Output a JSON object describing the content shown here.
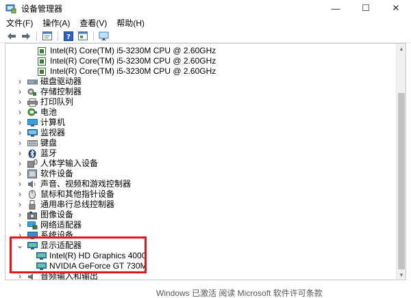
{
  "window": {
    "title": "设备管理器",
    "controls": {
      "minimize": "—",
      "maximize": "☐",
      "close": "✕"
    }
  },
  "menu": [
    {
      "label": "文件(F)"
    },
    {
      "label": "操作(A)"
    },
    {
      "label": "查看(V)"
    },
    {
      "label": "帮助(H)"
    }
  ],
  "toolbar": {
    "icons": [
      "back-arrow-icon",
      "forward-arrow-icon",
      "properties-icon",
      "help-icon",
      "update-icon",
      "monitor-scan-icon"
    ]
  },
  "tree": {
    "processors": [
      {
        "label": "Intel(R) Core(TM) i5-3230M CPU @ 2.60GHz"
      },
      {
        "label": "Intel(R) Core(TM) i5-3230M CPU @ 2.60GHz"
      },
      {
        "label": "Intel(R) Core(TM) i5-3230M CPU @ 2.60GHz"
      }
    ],
    "categories": [
      {
        "label": "磁盘驱动器",
        "icon": "disk-drive-icon",
        "expanded": false
      },
      {
        "label": "存储控制器",
        "icon": "storage-controller-icon",
        "expanded": false
      },
      {
        "label": "打印队列",
        "icon": "print-queue-icon",
        "expanded": false
      },
      {
        "label": "电池",
        "icon": "battery-icon",
        "expanded": false
      },
      {
        "label": "计算机",
        "icon": "computer-icon",
        "expanded": false
      },
      {
        "label": "监视器",
        "icon": "monitor-icon",
        "expanded": false
      },
      {
        "label": "键盘",
        "icon": "keyboard-icon",
        "expanded": false
      },
      {
        "label": "蓝牙",
        "icon": "bluetooth-icon",
        "expanded": false
      },
      {
        "label": "人体学输入设备",
        "icon": "hid-icon",
        "expanded": false
      },
      {
        "label": "软件设备",
        "icon": "software-device-icon",
        "expanded": false
      },
      {
        "label": "声音、视频和游戏控制器",
        "icon": "sound-icon",
        "expanded": false
      },
      {
        "label": "鼠标和其他指针设备",
        "icon": "mouse-icon",
        "expanded": false
      },
      {
        "label": "通用串行总线控制器",
        "icon": "usb-icon",
        "expanded": false
      },
      {
        "label": "图像设备",
        "icon": "camera-icon",
        "expanded": false
      },
      {
        "label": "网络适配器",
        "icon": "network-adapter-icon",
        "expanded": false
      },
      {
        "label": "系统设备",
        "icon": "system-device-icon",
        "expanded": false
      }
    ],
    "display_adapters": {
      "label": "显示适配器",
      "expanded": true,
      "children": [
        {
          "label": "Intel(R) HD Graphics 4000"
        },
        {
          "label": "NVIDIA GeForce GT 730M"
        }
      ]
    },
    "audio_io": {
      "label": "音频输入和输出",
      "expanded": false
    }
  },
  "watermark": "Windows 已激活     阅读 Microsoft 软件许可条款",
  "colors": {
    "highlight": "#e8101a",
    "cpu_icon": "#3a7a3a",
    "monitor_icon": "#2f8fd0"
  }
}
